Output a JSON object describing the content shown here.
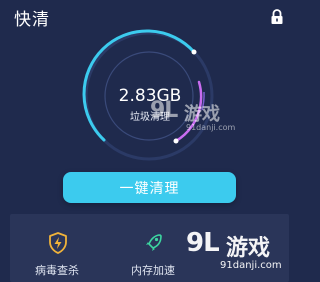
{
  "app": {
    "title": "快清"
  },
  "icons": {
    "lock": "lock-icon",
    "virus": "shield-lightning-icon",
    "memory": "rocket-icon"
  },
  "gauge": {
    "size": "2.83GB",
    "label": "垃圾清理"
  },
  "actions": {
    "clean_button": "一键清理"
  },
  "tools": [
    {
      "label": "病毒查杀",
      "icon": "shield-lightning-icon"
    },
    {
      "label": "内存加速",
      "icon": "rocket-icon"
    }
  ],
  "watermark": {
    "logo": "9L",
    "text": "游戏",
    "url": "91danji.com"
  },
  "colors": {
    "background": "#1f2a4d",
    "accent": "#3ccbee",
    "arc_secondary": "#c86cf0",
    "panel": "#2a3559"
  }
}
